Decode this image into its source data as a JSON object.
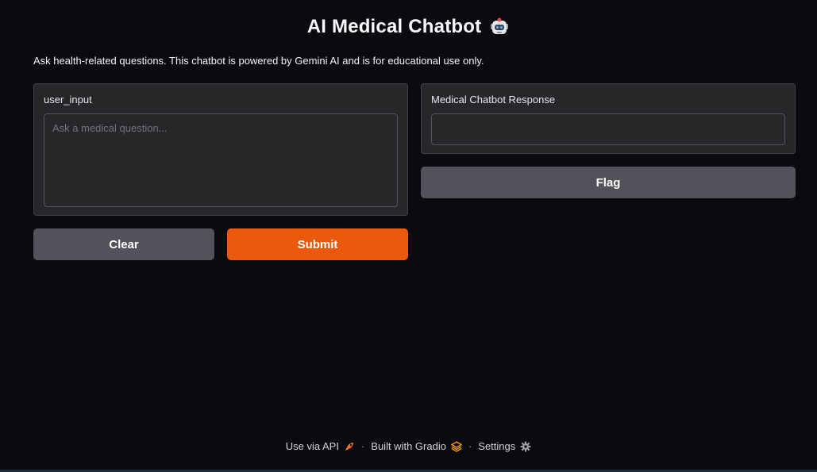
{
  "header": {
    "title": "AI Medical Chatbot",
    "title_icon": "robot-icon"
  },
  "description": "Ask health-related questions. This chatbot is powered by Gemini AI and is for educational use only.",
  "input_panel": {
    "label": "user_input",
    "placeholder": "Ask a medical question...",
    "value": ""
  },
  "output_panel": {
    "label": "Medical Chatbot Response",
    "value": ""
  },
  "buttons": {
    "clear": "Clear",
    "submit": "Submit",
    "flag": "Flag"
  },
  "footer": {
    "api_label": "Use via API",
    "api_icon": "rocket-icon",
    "built_label": "Built with Gradio",
    "built_icon": "gradio-logo-icon",
    "settings_label": "Settings",
    "settings_icon": "gear-icon",
    "separator": "·"
  },
  "colors": {
    "background": "#0b0b0f",
    "panel": "#27272a",
    "primary_button": "#ea580c",
    "secondary_button": "#52525b"
  }
}
